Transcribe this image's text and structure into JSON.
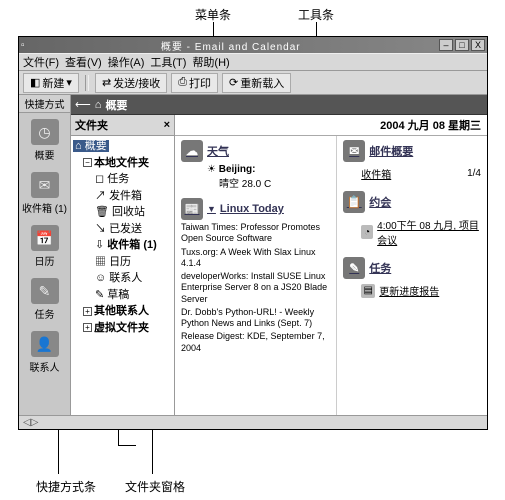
{
  "annotations": {
    "menubar": "菜单条",
    "toolbar": "工具条",
    "shortcut_bar": "快捷方式条",
    "folder_pane": "文件夹窗格"
  },
  "window": {
    "title": "概要 - Email and Calendar",
    "btn_min": "–",
    "btn_max": "□",
    "btn_close": "X"
  },
  "menubar": {
    "file": "文件(F)",
    "view": "查看(V)",
    "actions": "操作(A)",
    "tools": "工具(T)",
    "help": "帮助(H)"
  },
  "toolbar": {
    "new": "新建",
    "new_arrow": "▾",
    "send_recv": "发送/接收",
    "print": "打印",
    "reload": "重新载入"
  },
  "shortcut": {
    "header": "快捷方式",
    "items": [
      {
        "icon": "◷",
        "label": "概要"
      },
      {
        "icon": "✉",
        "label": "收件箱 (1)"
      },
      {
        "icon": "📅",
        "label": "日历"
      },
      {
        "icon": "✎",
        "label": "任务"
      },
      {
        "icon": "👤",
        "label": "联系人"
      }
    ]
  },
  "nav_header": {
    "arrow": "⟵",
    "icon": "⌂",
    "title": "概要"
  },
  "folder": {
    "title": "文件夹",
    "close": "×",
    "root": "概要",
    "local": "本地文件夹",
    "items": [
      "任务",
      "发件箱",
      "回收站",
      "已发送",
      "收件箱 (1)",
      "日历",
      "联系人",
      "草稿"
    ],
    "other": "其他联系人",
    "virtual": "虚拟文件夹"
  },
  "content": {
    "date": "2004 九月 08 星期三",
    "weather": {
      "title": "天气",
      "city": "Beijing:",
      "detail": "晴空 28.0 C"
    },
    "feed": {
      "title": "Linux Today",
      "drop": "▼",
      "items": [
        "Taiwan Times: Professor Promotes Open Source Software",
        "Tuxs.org: A Week With Slax Linux 4.1.4",
        "developerWorks: Install SUSE Linux Enterprise Server 8 on a JS20 Blade Server",
        "Dr. Dobb's Python-URL! - Weekly Python News and Links (Sept. 7)",
        "Release Digest: KDE, September 7, 2004"
      ]
    },
    "mail": {
      "title": "邮件概要",
      "inbox": "收件箱",
      "count": "1/4"
    },
    "appt": {
      "title": "约会",
      "item": "4:00下午 08 九月, 项目会议"
    },
    "tasks": {
      "title": "任务",
      "item": "更新进度报告"
    }
  }
}
